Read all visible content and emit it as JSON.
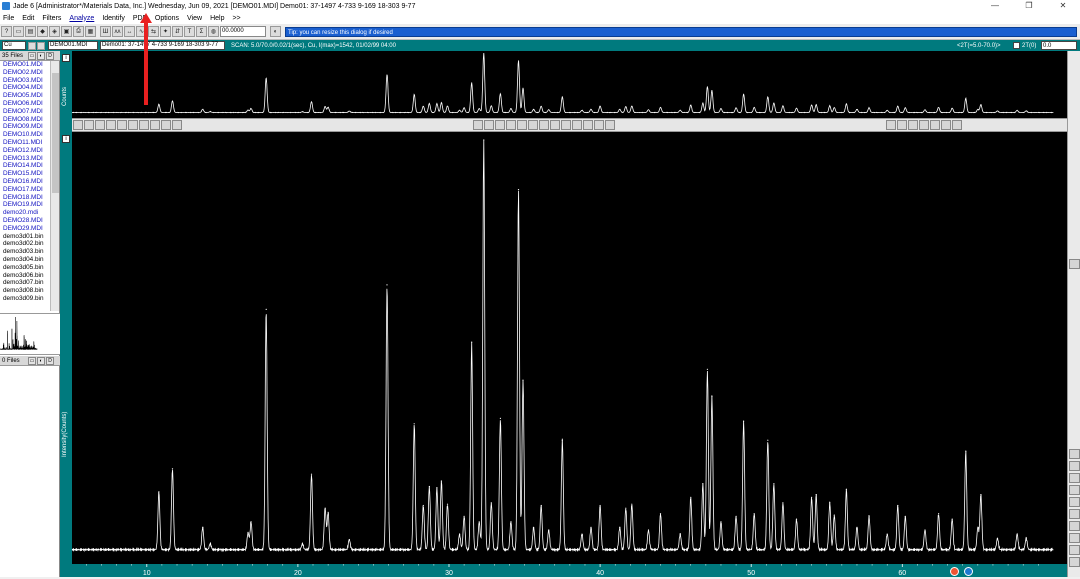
{
  "window": {
    "title": "Jade 6 [Administrator*/Materials Data, Inc.] Wednesday, Jun 09, 2021 [DEMO01.MDI] Demo01: 37-1497 4-733 9-169 18-303 9-77",
    "minimize": "—",
    "maximize": "❐",
    "close": "✕"
  },
  "menu": {
    "items": [
      "File",
      "Edit",
      "Filters",
      "Analyze",
      "Identify",
      "PDF",
      "Options",
      "View",
      "Help",
      ">>"
    ],
    "active": "Analyze"
  },
  "toolbar": {
    "zoom_value": "00.0000",
    "tip": "Tip: you can resize this dialog if desired"
  },
  "header": {
    "anode": "Cu",
    "file_select": "DEMO01.MDI",
    "pattern_select": "Demo01: 37-1497 4-733 9-169 18-303 9-77",
    "scan_info": "SCAN: 5.0/70.0/0.02/1(sec), Cu, I(max)=1542, 01/02/99 04:00",
    "range": "<2T(=5.0-70.0)>",
    "two_theta_label": "2T(0)",
    "two_theta_value": "0.0"
  },
  "files": {
    "count_label": "35 Files",
    "items": [
      {
        "name": "DEMO01.MDI",
        "type": "mdi"
      },
      {
        "name": "DEMO02.MDI",
        "type": "mdi"
      },
      {
        "name": "DEMO03.MDI",
        "type": "mdi"
      },
      {
        "name": "DEMO04.MDI",
        "type": "mdi"
      },
      {
        "name": "DEMO05.MDI",
        "type": "mdi"
      },
      {
        "name": "DEMO06.MDI",
        "type": "mdi"
      },
      {
        "name": "DEMO07.MDI",
        "type": "mdi"
      },
      {
        "name": "DEMO08.MDI",
        "type": "mdi"
      },
      {
        "name": "DEMO09.MDI",
        "type": "mdi"
      },
      {
        "name": "DEMO10.MDI",
        "type": "mdi"
      },
      {
        "name": "DEMO11.MDI",
        "type": "mdi"
      },
      {
        "name": "DEMO12.MDI",
        "type": "mdi"
      },
      {
        "name": "DEMO13.MDI",
        "type": "mdi"
      },
      {
        "name": "DEMO14.MDI",
        "type": "mdi"
      },
      {
        "name": "DEMO15.MDI",
        "type": "mdi"
      },
      {
        "name": "DEMO16.MDI",
        "type": "mdi"
      },
      {
        "name": "DEMO17.MDI",
        "type": "mdi"
      },
      {
        "name": "DEMO18.MDI",
        "type": "mdi"
      },
      {
        "name": "DEMO19.MDI",
        "type": "mdi"
      },
      {
        "name": "demo20.mdi",
        "type": "mdi"
      },
      {
        "name": "DEMO28.MDI",
        "type": "mdi"
      },
      {
        "name": "DEMO29.MDI",
        "type": "mdi"
      },
      {
        "name": "demo3d01.bin",
        "type": "bin"
      },
      {
        "name": "demo3d02.bin",
        "type": "bin"
      },
      {
        "name": "demo3d03.bin",
        "type": "bin"
      },
      {
        "name": "demo3d04.bin",
        "type": "bin"
      },
      {
        "name": "demo3d05.bin",
        "type": "bin"
      },
      {
        "name": "demo3d06.bin",
        "type": "bin"
      },
      {
        "name": "demo3d07.bin",
        "type": "bin"
      },
      {
        "name": "demo3d08.bin",
        "type": "bin"
      },
      {
        "name": "demo3d09.bin",
        "type": "bin"
      }
    ],
    "second_count_label": "0 Files"
  },
  "plot": {
    "overview_ylabel": "Counts",
    "main_ylabel": "Intensity(Counts)",
    "marker": "i"
  },
  "chart_data": {
    "type": "line",
    "xlim": [
      5,
      70
    ],
    "ylim": [
      0,
      1542
    ],
    "xticks": [
      10,
      20,
      30,
      40,
      50,
      60
    ],
    "baseline": 38,
    "peaks": [
      {
        "x": 10.8,
        "y": 250
      },
      {
        "x": 11.7,
        "y": 335
      },
      {
        "x": 13.7,
        "y": 120
      },
      {
        "x": 14.2,
        "y": 60
      },
      {
        "x": 16.7,
        "y": 100
      },
      {
        "x": 16.9,
        "y": 140
      },
      {
        "x": 17.9,
        "y": 920
      },
      {
        "x": 20.3,
        "y": 60
      },
      {
        "x": 20.9,
        "y": 315
      },
      {
        "x": 21.8,
        "y": 190
      },
      {
        "x": 22.0,
        "y": 175
      },
      {
        "x": 23.4,
        "y": 75
      },
      {
        "x": 25.9,
        "y": 1010
      },
      {
        "x": 27.7,
        "y": 500
      },
      {
        "x": 28.3,
        "y": 200
      },
      {
        "x": 28.7,
        "y": 270
      },
      {
        "x": 29.2,
        "y": 265
      },
      {
        "x": 29.5,
        "y": 290
      },
      {
        "x": 29.9,
        "y": 205
      },
      {
        "x": 30.7,
        "y": 95
      },
      {
        "x": 31.0,
        "y": 160
      },
      {
        "x": 31.5,
        "y": 800
      },
      {
        "x": 32.0,
        "y": 140
      },
      {
        "x": 32.3,
        "y": 1542
      },
      {
        "x": 32.8,
        "y": 210
      },
      {
        "x": 33.4,
        "y": 520
      },
      {
        "x": 34.1,
        "y": 140
      },
      {
        "x": 34.6,
        "y": 1360
      },
      {
        "x": 34.9,
        "y": 660
      },
      {
        "x": 35.6,
        "y": 120
      },
      {
        "x": 36.1,
        "y": 200
      },
      {
        "x": 36.6,
        "y": 110
      },
      {
        "x": 37.5,
        "y": 440
      },
      {
        "x": 38.8,
        "y": 95
      },
      {
        "x": 39.4,
        "y": 120
      },
      {
        "x": 40.0,
        "y": 200
      },
      {
        "x": 41.3,
        "y": 120
      },
      {
        "x": 41.7,
        "y": 190
      },
      {
        "x": 42.1,
        "y": 205
      },
      {
        "x": 43.2,
        "y": 110
      },
      {
        "x": 44.0,
        "y": 170
      },
      {
        "x": 45.3,
        "y": 95
      },
      {
        "x": 46.0,
        "y": 230
      },
      {
        "x": 46.8,
        "y": 280
      },
      {
        "x": 47.1,
        "y": 700
      },
      {
        "x": 47.4,
        "y": 600
      },
      {
        "x": 48.0,
        "y": 140
      },
      {
        "x": 49.0,
        "y": 160
      },
      {
        "x": 49.5,
        "y": 510
      },
      {
        "x": 50.2,
        "y": 170
      },
      {
        "x": 51.1,
        "y": 440
      },
      {
        "x": 51.5,
        "y": 280
      },
      {
        "x": 52.1,
        "y": 210
      },
      {
        "x": 53.0,
        "y": 150
      },
      {
        "x": 54.0,
        "y": 230
      },
      {
        "x": 54.3,
        "y": 240
      },
      {
        "x": 55.2,
        "y": 210
      },
      {
        "x": 55.5,
        "y": 165
      },
      {
        "x": 56.3,
        "y": 260
      },
      {
        "x": 57.0,
        "y": 120
      },
      {
        "x": 57.8,
        "y": 160
      },
      {
        "x": 59.0,
        "y": 95
      },
      {
        "x": 59.7,
        "y": 200
      },
      {
        "x": 60.2,
        "y": 160
      },
      {
        "x": 61.5,
        "y": 110
      },
      {
        "x": 62.4,
        "y": 170
      },
      {
        "x": 63.3,
        "y": 150
      },
      {
        "x": 64.2,
        "y": 400
      },
      {
        "x": 65.0,
        "y": 120
      },
      {
        "x": 65.2,
        "y": 240
      },
      {
        "x": 66.3,
        "y": 80
      },
      {
        "x": 67.6,
        "y": 95
      },
      {
        "x": 68.2,
        "y": 80
      }
    ]
  }
}
